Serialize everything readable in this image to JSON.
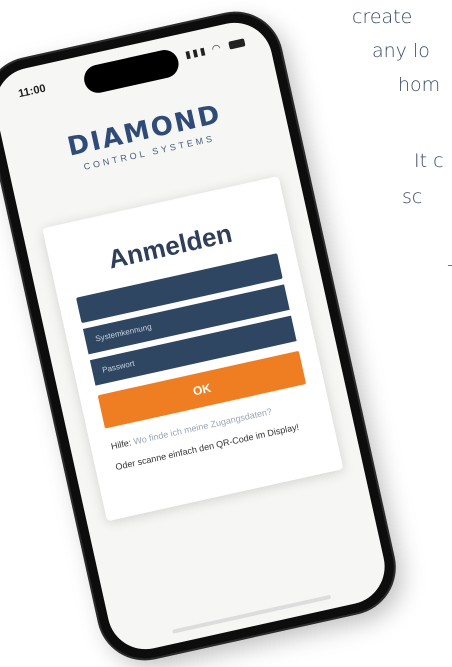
{
  "side_text": [
    "create",
    "any lo",
    "hom",
    "It c",
    "sc",
    "-"
  ],
  "status": {
    "time": "11:00",
    "signal": "▮▮▮"
  },
  "logo": {
    "word": "DIAMOND",
    "subtitle": "CONTROL SYSTEMS"
  },
  "login": {
    "title": "Anmelden",
    "system_placeholder": "Systemkennung",
    "password_placeholder": "Passwort",
    "ok_label": "OK",
    "help_prefix": "Hilfe:",
    "help_link": "Wo finde ich meine Zugangsdaten?",
    "hint": "Oder scanne einfach den QR-Code im Display!"
  }
}
